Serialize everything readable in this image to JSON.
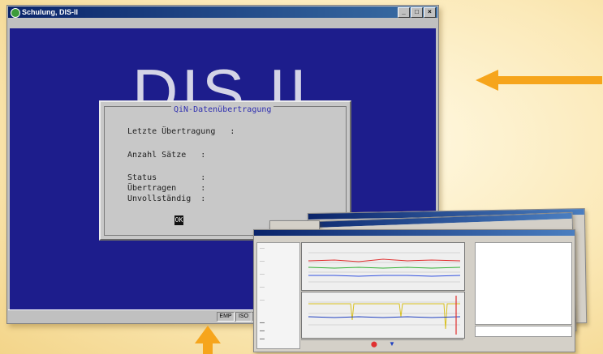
{
  "window": {
    "title": "Schulung, DIS-II",
    "min_btn": "_",
    "max_btn": "□",
    "close_btn": "×"
  },
  "client": {
    "logo_text": "DIS II"
  },
  "dialog": {
    "title": "QiN-Datenübertragung",
    "rows": [
      "Letzte Übertragung   :",
      "Anzahl Sätze   :",
      "Status         :",
      "Übertragen     :",
      "Unvollständig  :"
    ],
    "ok_label": "OK"
  },
  "statusbar": {
    "cells": [
      "EMP",
      "ISO"
    ]
  },
  "colors": {
    "client_bg": "#1d1d8c",
    "arrow": "#f6a51c",
    "titlebar": "#0a246a"
  }
}
